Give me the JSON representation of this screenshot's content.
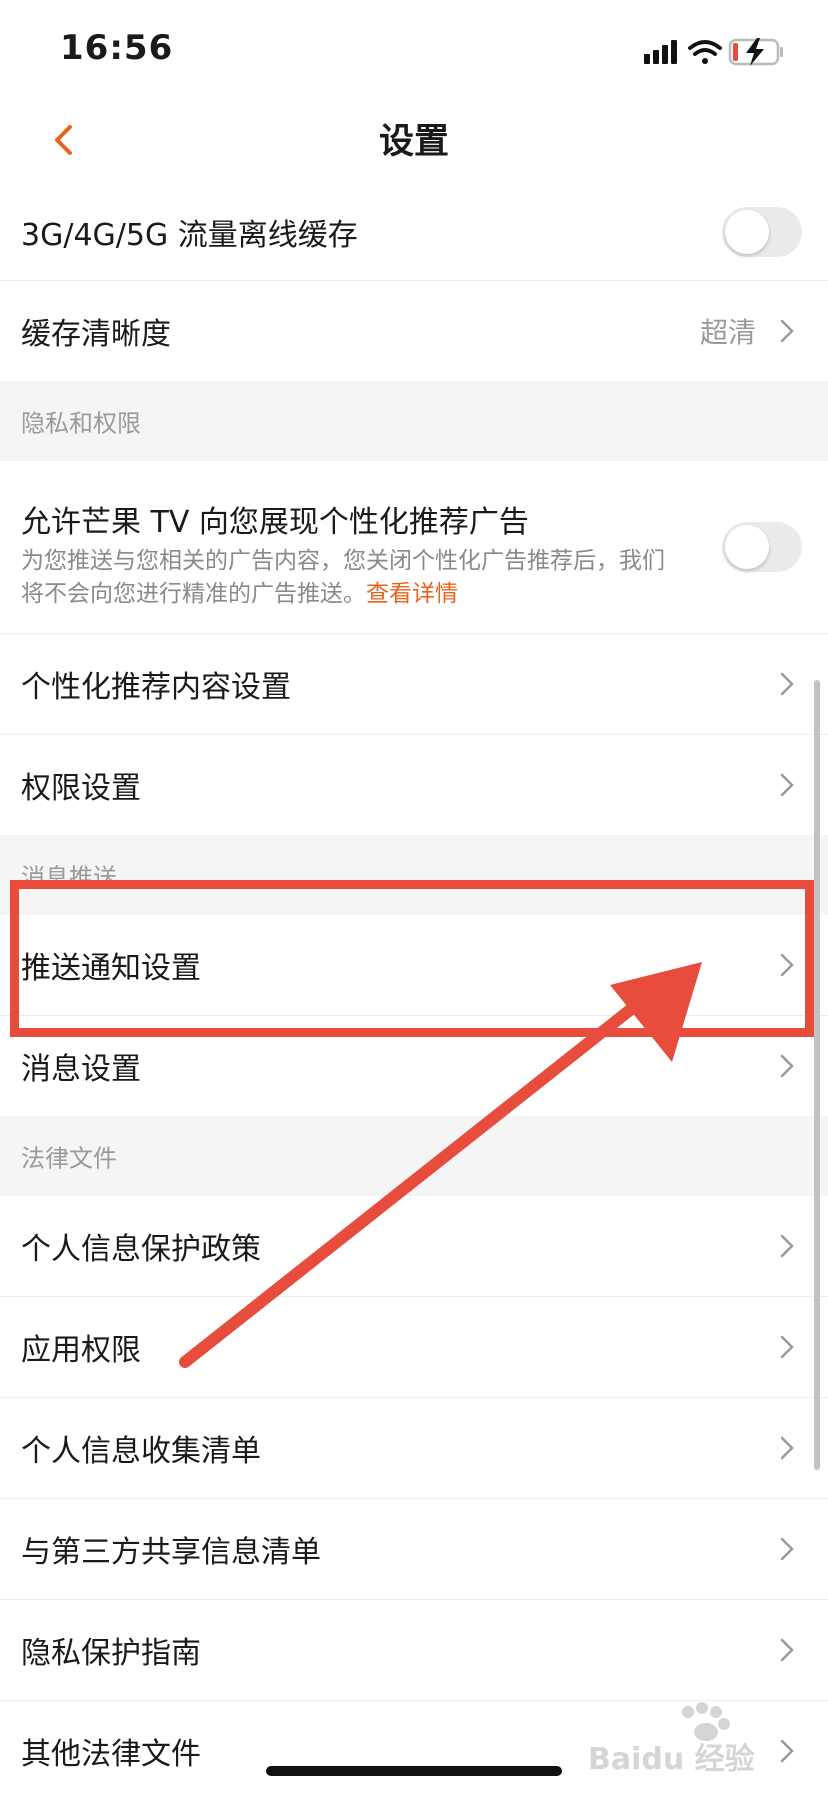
{
  "status_bar": {
    "time": "16:56"
  },
  "nav": {
    "title": "设置"
  },
  "rows_top": [
    {
      "label": "3G/4G/5G 流量离线缓存",
      "toggle": false
    },
    {
      "label": "缓存清晰度",
      "value": "超清"
    }
  ],
  "sections": {
    "privacy": "隐私和权限",
    "messages": "消息推送",
    "legal": "法律文件"
  },
  "privacy_items": {
    "ads": {
      "label": "允许芒果 TV 向您展现个性化推荐广告",
      "description": "为您推送与您相关的广告内容，您关闭个性化广告推荐后，我们将不会向您进行精准的广告推送。",
      "link": "查看详情",
      "toggle": false
    },
    "content": "个性化推荐内容设置",
    "permissions": "权限设置"
  },
  "message_items": [
    "推送通知设置",
    "消息设置"
  ],
  "legal_items": [
    "个人信息保护政策",
    "应用权限",
    "个人信息收集清单",
    "与第三方共享信息清单",
    "隐私保护指南",
    "其他法律文件"
  ],
  "watermark": "Baidu 经验",
  "colors": {
    "accent": "#e8641e",
    "annotation": "#e84c3d",
    "section_bg": "#f5f5f5"
  }
}
